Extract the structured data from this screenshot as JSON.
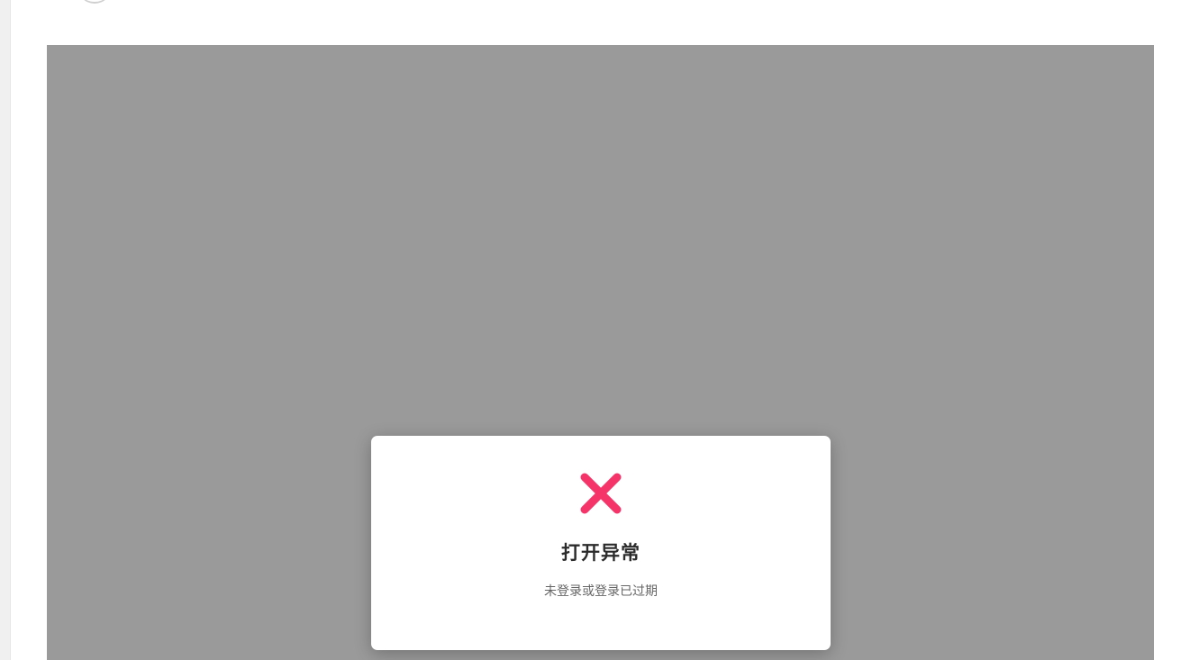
{
  "dialog": {
    "icon": "close-x-icon",
    "title": "打开异常",
    "message": "未登录或登录已过期"
  },
  "colors": {
    "overlay": "#9a9a9a",
    "error_accent": "#f5346a"
  }
}
